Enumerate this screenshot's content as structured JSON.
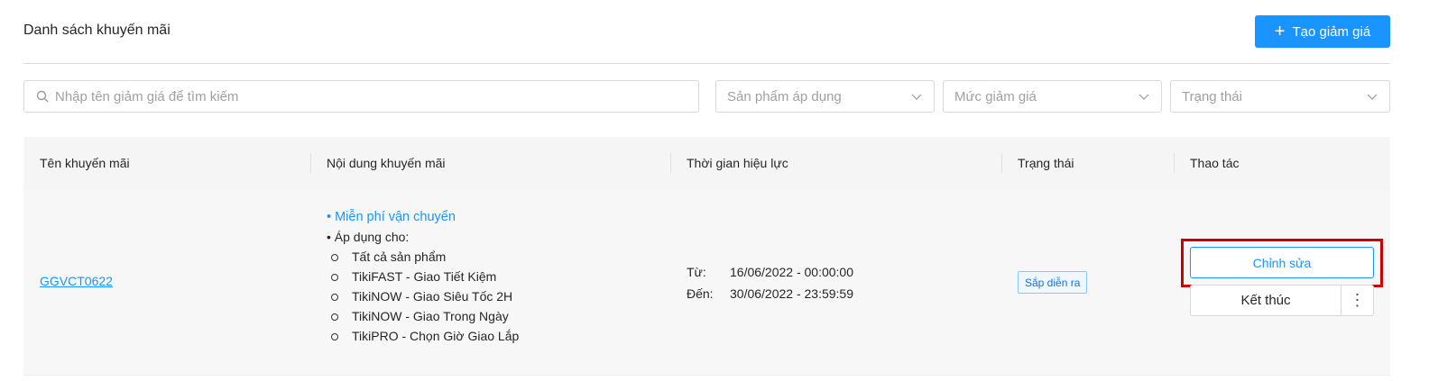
{
  "header": {
    "title": "Danh sách khuyến mãi",
    "create_label": "Tạo giảm giá"
  },
  "filters": {
    "search_placeholder": "Nhập tên giảm giá để tìm kiếm",
    "product_placeholder": "Sản phẩm áp dụng",
    "discount_placeholder": "Mức giảm giá",
    "status_placeholder": "Trạng thái"
  },
  "table": {
    "columns": [
      "Tên khuyến mãi",
      "Nội dung khuyến mãi",
      "Thời gian hiệu lực",
      "Trạng thái",
      "Thao tác"
    ],
    "rows": [
      {
        "code": "GGVCT0622",
        "content": {
          "headline": "• Miễn phí vận chuyển",
          "apply_label": "• Áp dụng cho:",
          "items": [
            "Tất cả sản phẩm",
            "TikiFAST - Giao Tiết Kiệm",
            "TikiNOW - Giao Siêu Tốc 2H",
            "TikiNOW - Giao Trong Ngày",
            "TikiPRO - Chọn Giờ Giao Lắp"
          ]
        },
        "time": {
          "from_label": "Từ:",
          "from_value": "16/06/2022 - 00:00:00",
          "to_label": "Đến:",
          "to_value": "30/06/2022 - 23:59:59"
        },
        "status": "Sắp diễn ra",
        "actions": {
          "edit_label": "Chỉnh sửa",
          "end_label": "Kết thúc",
          "more_label": "⋮"
        }
      }
    ]
  },
  "colors": {
    "accent": "#1a94ff",
    "highlight": "#cc0000",
    "header_bg": "#f5f5f5"
  }
}
